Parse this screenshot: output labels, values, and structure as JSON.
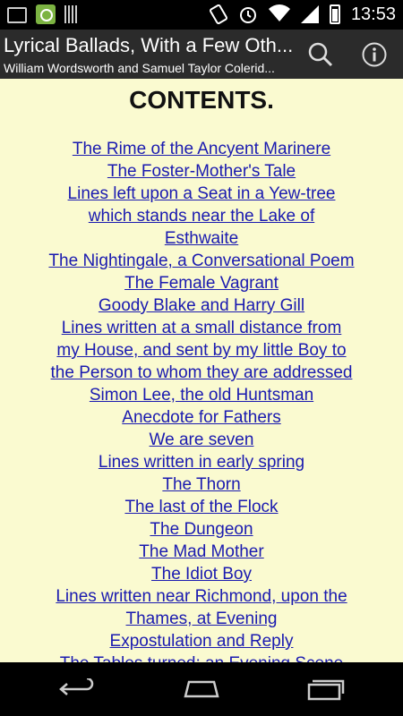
{
  "status_bar": {
    "time": "13:53",
    "icons": [
      "sd-card-icon",
      "app-notification-icon",
      "barcode-icon",
      "rotate-icon",
      "alarm-icon",
      "wifi-icon",
      "signal-icon",
      "battery-icon"
    ]
  },
  "app_bar": {
    "title": "Lyrical Ballads, With a Few Oth...",
    "subtitle": "William Wordsworth and Samuel Taylor Colerid...",
    "actions": [
      "search-icon",
      "info-icon"
    ]
  },
  "content": {
    "heading": "CONTENTS.",
    "toc": [
      [
        "The Rime of the Ancyent Marinere"
      ],
      [
        "The Foster-Mother's Tale"
      ],
      [
        "Lines left upon a Seat in a Yew-tree",
        "which stands near the Lake of",
        "Esthwaite"
      ],
      [
        "The Nightingale, a Conversational Poem"
      ],
      [
        "The Female Vagrant"
      ],
      [
        "Goody Blake and Harry Gill"
      ],
      [
        "Lines written at a small distance from",
        "my House, and sent by my little Boy to",
        "the Person to whom they are addressed"
      ],
      [
        "Simon Lee, the old Huntsman"
      ],
      [
        "Anecdote for Fathers"
      ],
      [
        "We are seven"
      ],
      [
        "Lines written in early spring"
      ],
      [
        "The Thorn"
      ],
      [
        "The last of the Flock"
      ],
      [
        "The Dungeon"
      ],
      [
        "The Mad Mother"
      ],
      [
        "The Idiot Boy"
      ],
      [
        "Lines written near Richmond, upon the",
        "Thames, at Evening"
      ],
      [
        "Expostulation and Reply"
      ],
      [
        "The Tables turned; an Evening Scene"
      ]
    ]
  },
  "colors": {
    "page_background": "#fafad0",
    "link": "#1a1ab0",
    "app_bar": "#2b2b2b"
  }
}
